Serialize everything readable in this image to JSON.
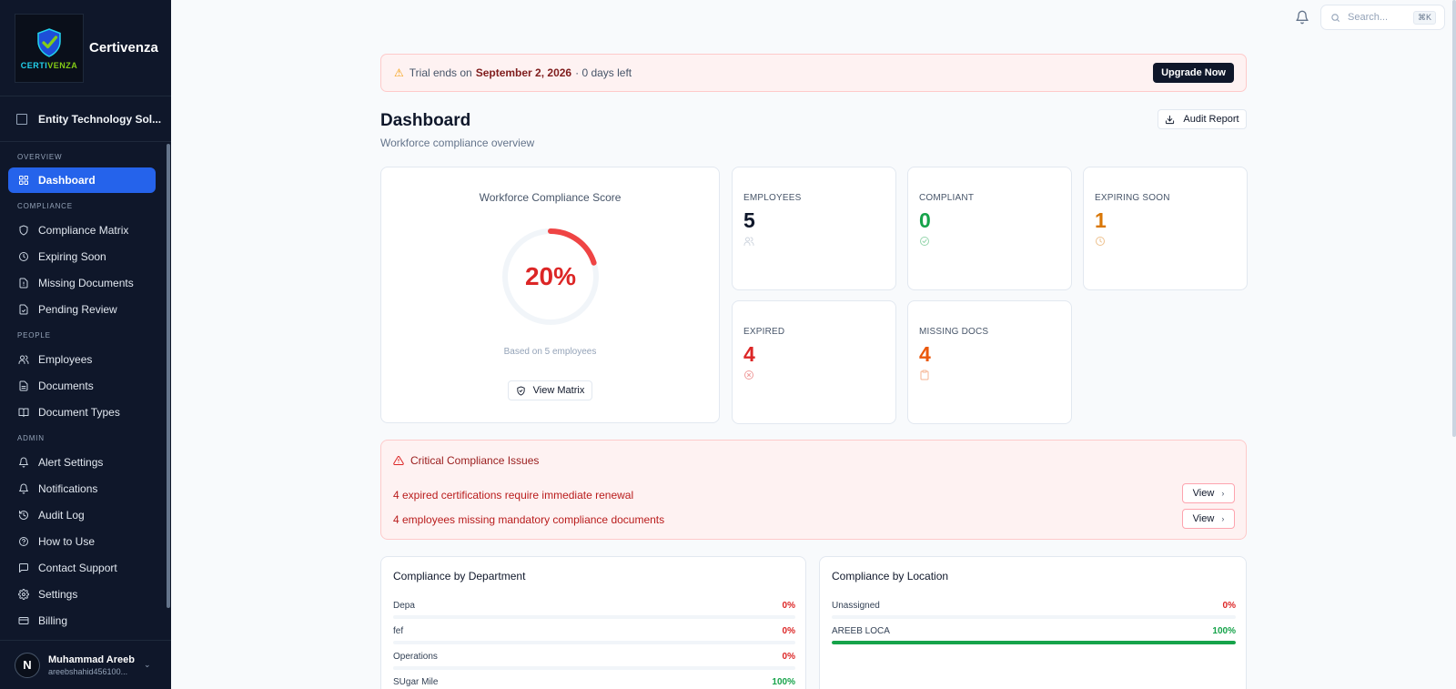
{
  "brand": {
    "name": "Certivenza",
    "logo_word_a": "CERTI",
    "logo_word_b": "VENZA"
  },
  "entity": {
    "name": "Entity Technology Sol..."
  },
  "sidebar": {
    "sections": [
      {
        "label": "OVERVIEW",
        "items": [
          {
            "label": "Dashboard",
            "icon": "grid-icon",
            "active": true
          }
        ]
      },
      {
        "label": "COMPLIANCE",
        "items": [
          {
            "label": "Compliance Matrix",
            "icon": "shield-icon"
          },
          {
            "label": "Expiring Soon",
            "icon": "clock-icon"
          },
          {
            "label": "Missing Documents",
            "icon": "file-alert-icon"
          },
          {
            "label": "Pending Review",
            "icon": "file-check-icon"
          }
        ]
      },
      {
        "label": "PEOPLE",
        "items": [
          {
            "label": "Employees",
            "icon": "users-icon"
          },
          {
            "label": "Documents",
            "icon": "file-text-icon"
          },
          {
            "label": "Document Types",
            "icon": "book-icon"
          }
        ]
      },
      {
        "label": "ADMIN",
        "items": [
          {
            "label": "Alert Settings",
            "icon": "bell-icon"
          },
          {
            "label": "Notifications",
            "icon": "bell-icon"
          },
          {
            "label": "Audit Log",
            "icon": "history-icon"
          },
          {
            "label": "How to Use",
            "icon": "help-icon"
          },
          {
            "label": "Contact Support",
            "icon": "message-icon"
          },
          {
            "label": "Settings",
            "icon": "gear-icon"
          },
          {
            "label": "Billing",
            "icon": "card-icon"
          }
        ]
      }
    ]
  },
  "user": {
    "initial": "N",
    "name": "Muhammad Areeb",
    "email": "areebshahid456100..."
  },
  "search": {
    "placeholder": "Search...",
    "shortcut": "⌘K"
  },
  "trial": {
    "prefix": "Trial ends on",
    "date": "September 2, 2026",
    "suffix": "· 0 days left",
    "cta": "Upgrade Now"
  },
  "header": {
    "title": "Dashboard",
    "subtitle": "Workforce compliance overview",
    "audit_label": "Audit Report"
  },
  "score": {
    "title": "Workforce Compliance Score",
    "value": 20,
    "label": "20%",
    "based_on": "Based on 5 employees",
    "button": "View Matrix"
  },
  "stats": [
    {
      "label": "EMPLOYEES",
      "value": "5",
      "color": "#0f172a",
      "icon": "users-icon"
    },
    {
      "label": "COMPLIANT",
      "value": "0",
      "color": "#16a34a",
      "icon": "check-circle-icon"
    },
    {
      "label": "EXPIRING SOON",
      "value": "1",
      "color": "#d97706",
      "icon": "clock-icon"
    },
    {
      "label": "EXPIRED",
      "value": "4",
      "color": "#dc2626",
      "icon": "x-circle-icon"
    },
    {
      "label": "MISSING DOCS",
      "value": "4",
      "color": "#ea580c",
      "icon": "clipboard-icon"
    }
  ],
  "issues": {
    "title": "Critical Compliance Issues",
    "rows": [
      {
        "text": "4 expired certifications require immediate renewal",
        "button": "View"
      },
      {
        "text": "4 employees missing mandatory compliance documents",
        "button": "View"
      }
    ]
  },
  "departments": {
    "title": "Compliance by Department",
    "rows": [
      {
        "name": "Depa",
        "label": "0%",
        "value": 0
      },
      {
        "name": "fef",
        "label": "0%",
        "value": 0
      },
      {
        "name": "Operations",
        "label": "0%",
        "value": 0
      },
      {
        "name": "SUgar Mile",
        "label": "100%",
        "value": 100
      }
    ]
  },
  "locations": {
    "title": "Compliance by Location",
    "rows": [
      {
        "name": "Unassigned",
        "label": "0%",
        "value": 0
      },
      {
        "name": "AREEB LOCA",
        "label": "100%",
        "value": 100
      }
    ]
  }
}
